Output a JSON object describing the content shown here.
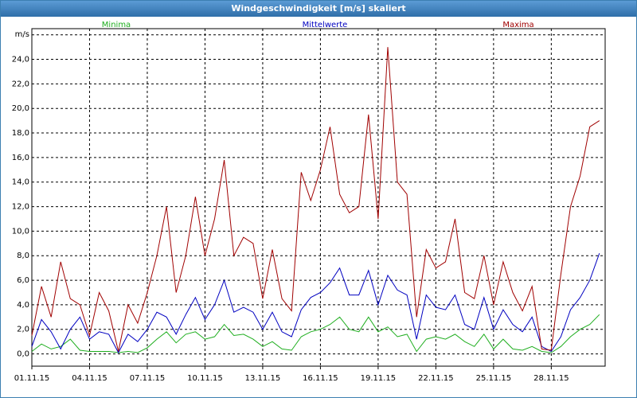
{
  "window": {
    "title": "Windgeschwindigkeit [m/s] skaliert"
  },
  "chart_data": {
    "type": "line",
    "title": "Windgeschwindigkeit [m/s] skaliert",
    "ylabel": "m/s",
    "xlabel": "",
    "ylim": [
      -1,
      26.5
    ],
    "xlim": [
      0,
      29.8
    ],
    "grid": true,
    "legend_position": "top",
    "y_ticks": [
      "0,0",
      "2,0",
      "4,0",
      "6,0",
      "8,0",
      "10,0",
      "12,0",
      "14,0",
      "16,0",
      "18,0",
      "20,0",
      "22,0",
      "24,0"
    ],
    "x_ticks": [
      {
        "label": "01.11.15",
        "day": 0
      },
      {
        "label": "04.11.15",
        "day": 3
      },
      {
        "label": "07.11.15",
        "day": 6
      },
      {
        "label": "10.11.15",
        "day": 9
      },
      {
        "label": "13.11.15",
        "day": 12
      },
      {
        "label": "16.11.15",
        "day": 15
      },
      {
        "label": "19.11.15",
        "day": 18
      },
      {
        "label": "22.11.15",
        "day": 21
      },
      {
        "label": "25.11.15",
        "day": 24
      },
      {
        "label": "28.11.15",
        "day": 27
      }
    ],
    "x_unit_note": "day index from 01.11.15",
    "x": [
      0,
      0.5,
      1,
      1.5,
      2,
      2.5,
      3,
      3.5,
      4,
      4.5,
      5,
      5.5,
      6,
      6.5,
      7,
      7.5,
      8,
      8.5,
      9,
      9.5,
      10,
      10.5,
      11,
      11.5,
      12,
      12.5,
      13,
      13.5,
      14,
      14.5,
      15,
      15.5,
      16,
      16.5,
      17,
      17.5,
      18,
      18.5,
      19,
      19.5,
      20,
      20.5,
      21,
      21.5,
      22,
      22.5,
      23,
      23.5,
      24,
      24.5,
      25,
      25.5,
      26,
      26.5,
      27,
      27.5,
      28,
      28.5,
      29,
      29.5
    ],
    "series": [
      {
        "name": "Minima",
        "color": "#1fae1f",
        "values": [
          0.2,
          0.8,
          0.4,
          0.6,
          1.2,
          0.3,
          0.2,
          0.2,
          0.2,
          0.1,
          0.2,
          0.1,
          0.5,
          1.2,
          1.8,
          0.9,
          1.6,
          1.8,
          1.2,
          1.4,
          2.4,
          1.5,
          1.6,
          1.2,
          0.6,
          1.0,
          0.4,
          0.3,
          1.4,
          1.8,
          2.0,
          2.4,
          3.0,
          2.0,
          1.8,
          3.0,
          1.8,
          2.2,
          1.4,
          1.6,
          0.2,
          1.2,
          1.4,
          1.2,
          1.6,
          1.0,
          0.6,
          1.6,
          0.4,
          1.2,
          0.4,
          0.3,
          0.6,
          0.2,
          0.1,
          0.6,
          1.4,
          2.0,
          2.4,
          3.2
        ]
      },
      {
        "name": "Mittelwerte",
        "color": "#0000c0",
        "values": [
          0.6,
          2.8,
          1.8,
          0.4,
          2.0,
          3.0,
          1.2,
          1.8,
          1.6,
          0.1,
          1.6,
          1.0,
          2.0,
          3.4,
          3.0,
          1.6,
          3.2,
          4.6,
          2.8,
          4.0,
          6.0,
          3.4,
          3.8,
          3.4,
          2.0,
          3.4,
          1.8,
          1.4,
          3.6,
          4.6,
          5.0,
          5.8,
          7.0,
          4.8,
          4.8,
          6.8,
          4.0,
          6.4,
          5.2,
          4.8,
          1.2,
          4.8,
          3.8,
          3.6,
          4.8,
          2.4,
          2.0,
          4.6,
          2.0,
          3.6,
          2.4,
          1.8,
          3.0,
          0.6,
          0.2,
          1.4,
          3.6,
          4.6,
          6.0,
          8.2
        ]
      },
      {
        "name": "Maxima",
        "color": "#a00000",
        "values": [
          1.5,
          5.5,
          3.0,
          7.5,
          4.5,
          4.0,
          1.5,
          5.0,
          3.5,
          0.2,
          4.0,
          2.5,
          5.0,
          8.0,
          12.0,
          5.0,
          8.0,
          12.8,
          8.0,
          11.0,
          15.8,
          8.0,
          9.5,
          9.0,
          4.5,
          8.5,
          4.5,
          3.5,
          14.8,
          12.5,
          15.0,
          18.5,
          13.0,
          11.5,
          12.0,
          19.5,
          11.0,
          25.0,
          14.0,
          13.0,
          3.0,
          8.5,
          7.0,
          7.5,
          11.0,
          5.0,
          4.5,
          8.0,
          4.0,
          7.5,
          5.0,
          3.5,
          5.5,
          0.4,
          0.3,
          6.5,
          12.0,
          14.5,
          18.5,
          19.0
        ]
      }
    ]
  }
}
